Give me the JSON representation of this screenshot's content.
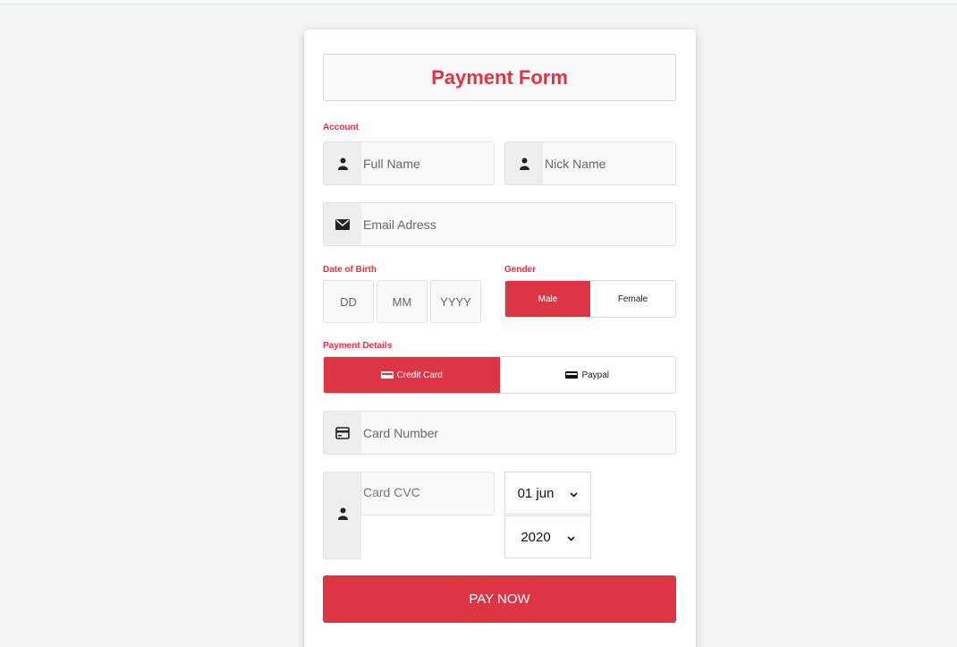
{
  "form": {
    "title": "Payment Form",
    "pay_label": "PAY NOW"
  },
  "account": {
    "label": "Account",
    "full_name_placeholder": "Full Name",
    "nick_name_placeholder": "Nick Name",
    "email_placeholder": "Email Adress"
  },
  "dob": {
    "label": "Date of Birth",
    "day_placeholder": "DD",
    "month_placeholder": "MM",
    "year_placeholder": "YYYY"
  },
  "gender": {
    "label": "Gender",
    "male": "Male",
    "female": "Female",
    "selected": "Male"
  },
  "payment": {
    "label": "Payment Details",
    "credit_card": "Credit Card",
    "paypal": "Paypal",
    "selected": "Credit Card",
    "card_number_placeholder": "Card Number",
    "cvc_placeholder": "Card CVC",
    "expiry_day_selected": "01 jun",
    "expiry_year_selected": "2020"
  },
  "icons": {
    "user": "user-icon",
    "email": "envelope-icon",
    "card": "credit-card-icon",
    "chevron": "chevron-down-icon"
  },
  "colors": {
    "accent": "#dc3545",
    "background": "#f5f5f5",
    "card": "#ffffff"
  }
}
